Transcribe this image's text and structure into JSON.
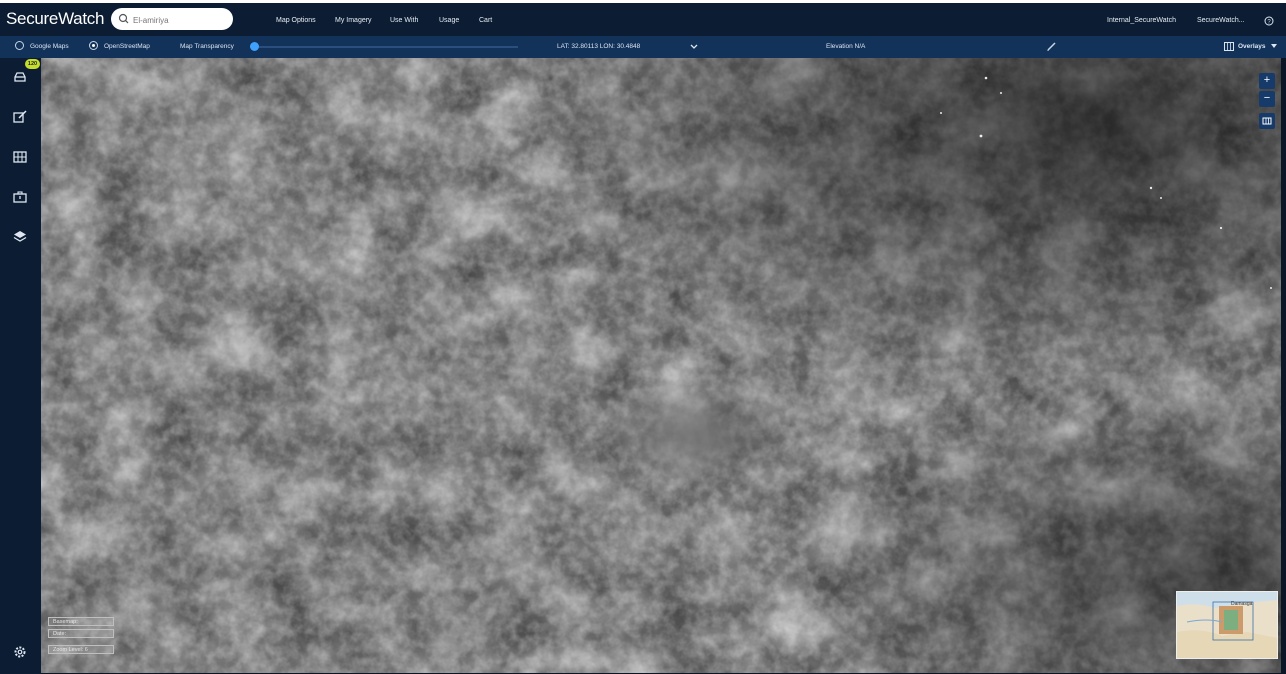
{
  "app": {
    "title": "SecureWatch"
  },
  "search": {
    "placeholder": "Q El-amiriya",
    "value": "El-amiriya"
  },
  "menu": {
    "items": [
      "Map Options",
      "My Imagery",
      "Use With",
      "Usage",
      "Cart"
    ]
  },
  "user": {
    "org": "Internal_SecureWatch",
    "account": "SecureWatch...",
    "help_icon": "help-circle-icon"
  },
  "basemap": {
    "google": "Google Maps",
    "osm": "OpenStreetMap",
    "selected": "OpenStreetMap"
  },
  "transparency": {
    "label": "Map Transparency",
    "value": 0
  },
  "coords": {
    "text": "LAT: 32.80113 LON: 30.4848"
  },
  "elevation": {
    "text": "Elevation N/A"
  },
  "overlays": {
    "label": "Overlays"
  },
  "sidebar": {
    "badge": "120",
    "items": [
      "orders-icon",
      "edit-icon",
      "grid-icon",
      "briefcase-icon",
      "layers-icon"
    ],
    "settings": "settings-icon"
  },
  "zoom": {
    "in": "+",
    "out": "−"
  },
  "info": {
    "line1": "Basemap:",
    "line2": "Date:",
    "zoom": "Zoom Level: 6"
  },
  "minimap": {
    "label": "Damasga"
  },
  "colors": {
    "topbar": "#0b1c33",
    "secbar": "#13325a",
    "accent": "#3fa2ff",
    "badge": "#c8dc2a"
  }
}
